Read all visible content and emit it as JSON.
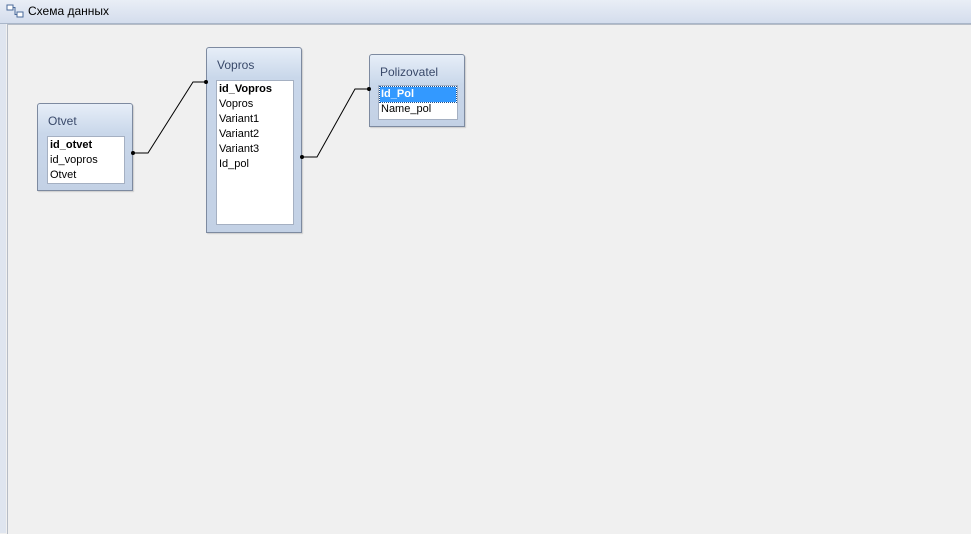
{
  "tab": {
    "title": "Схема данных",
    "icon": "relationships-icon"
  },
  "tables": {
    "otvet": {
      "title": "Otvet",
      "fields": [
        {
          "label": "id_otvet",
          "key": true
        },
        {
          "label": "id_vopros",
          "key": false
        },
        {
          "label": "Otvet",
          "key": false
        }
      ]
    },
    "vopros": {
      "title": "Vopros",
      "fields": [
        {
          "label": "id_Vopros",
          "key": true
        },
        {
          "label": "Vopros",
          "key": false
        },
        {
          "label": "Variant1",
          "key": false
        },
        {
          "label": "Variant2",
          "key": false
        },
        {
          "label": "Variant3",
          "key": false
        },
        {
          "label": "Id_pol",
          "key": false
        }
      ]
    },
    "polizovatel": {
      "title": "Polizovatel",
      "fields": [
        {
          "label": "Id_Pol",
          "key": true,
          "selected": true
        },
        {
          "label": "Name_pol",
          "key": false
        }
      ]
    }
  },
  "relationships": [
    {
      "from": "Otvet.id_vopros",
      "to": "Vopros.id_Vopros"
    },
    {
      "from": "Vopros.Id_pol",
      "to": "Polizovatel.Id_Pol"
    }
  ]
}
